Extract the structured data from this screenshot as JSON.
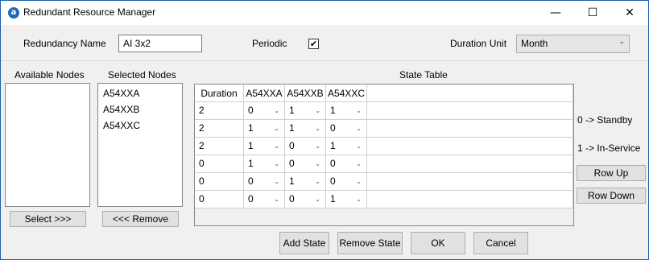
{
  "window": {
    "title": "Redundant Resource Manager",
    "app_icon_letter": "a",
    "controls": {
      "minimize": "—",
      "maximize": "☐",
      "close": "✕"
    }
  },
  "form": {
    "redundancy_name_label": "Redundancy Name",
    "redundancy_name_value": "AI 3x2",
    "periodic_label": "Periodic",
    "periodic_checked": true,
    "duration_unit_label": "Duration Unit",
    "duration_unit_value": "Month"
  },
  "available_nodes": {
    "label": "Available Nodes",
    "items": []
  },
  "selected_nodes": {
    "label": "Selected Nodes",
    "items": [
      "A54XXA",
      "A54XXB",
      "A54XXC"
    ]
  },
  "state_table": {
    "label": "State Table",
    "columns": [
      "Duration",
      "A54XXA",
      "A54XXB",
      "A54XXC"
    ],
    "rows": [
      [
        "2",
        "0",
        "1",
        "1"
      ],
      [
        "2",
        "1",
        "1",
        "0"
      ],
      [
        "2",
        "1",
        "0",
        "1"
      ],
      [
        "0",
        "1",
        "0",
        "0"
      ],
      [
        "0",
        "0",
        "1",
        "0"
      ],
      [
        "0",
        "0",
        "0",
        "1"
      ]
    ]
  },
  "legend": {
    "standby": "0 -> Standby",
    "in_service": "1 -> In-Service"
  },
  "buttons": {
    "select": "Select >>>",
    "remove": "<<< Remove",
    "row_up": "Row Up",
    "row_down": "Row Down",
    "add_state": "Add State",
    "remove_state": "Remove State",
    "ok": "OK",
    "cancel": "Cancel"
  },
  "icons": {
    "check": "✔",
    "dropdown": "⌄"
  }
}
